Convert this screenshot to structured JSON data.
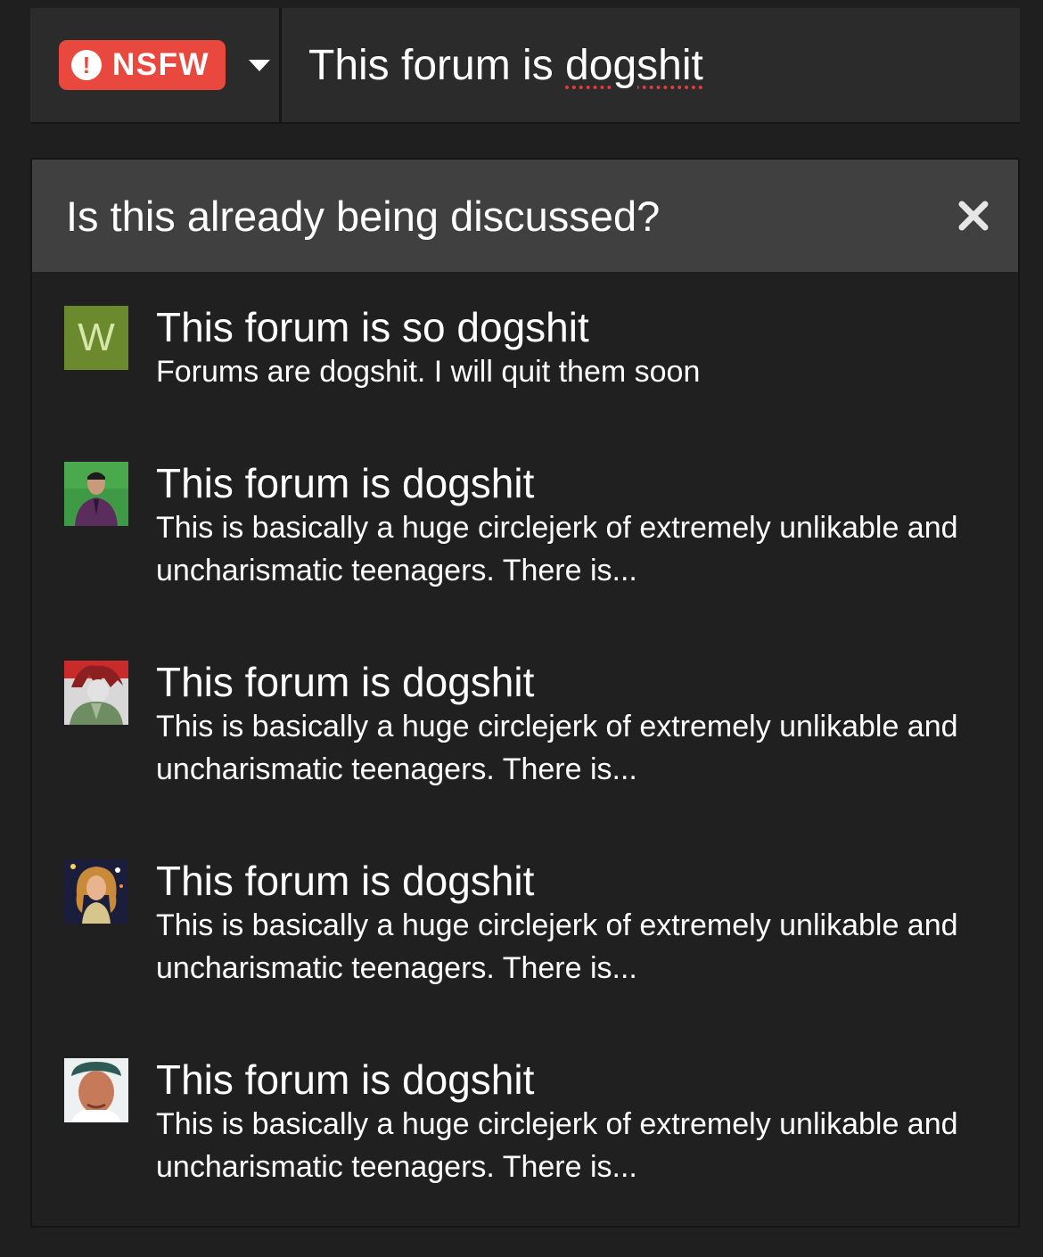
{
  "composer": {
    "prefix_tag": "NSFW",
    "prefix_icon": "exclamation-circle-icon",
    "title_prefix": "This forum is ",
    "title_misspelled": "dogshit"
  },
  "suggestions": {
    "heading": "Is this already being discussed?",
    "close_icon": "close-icon",
    "items": [
      {
        "avatar_letter": "W",
        "title": "This forum is so dogshit",
        "excerpt": "Forums are dogshit. I will quit them soon"
      },
      {
        "title": "This forum is dogshit",
        "excerpt": "This is basically a huge circlejerk of extremely unlikable and uncharismatic teenagers. There is..."
      },
      {
        "title": "This forum is dogshit",
        "excerpt": "This is basically a huge circlejerk of extremely unlikable and uncharismatic teenagers. There is..."
      },
      {
        "title": "This forum is dogshit",
        "excerpt": "This is basically a huge circlejerk of extremely unlikable and uncharismatic teenagers. There is..."
      },
      {
        "title": "This forum is dogshit",
        "excerpt": "This is basically a huge circlejerk of extremely unlikable and uncharismatic teenagers. There is..."
      }
    ]
  },
  "colors": {
    "nsfw_badge": "#e9483f",
    "panel_header": "#404040",
    "background": "#1f1f1f",
    "letter_avatar": "#6b8a2e"
  }
}
